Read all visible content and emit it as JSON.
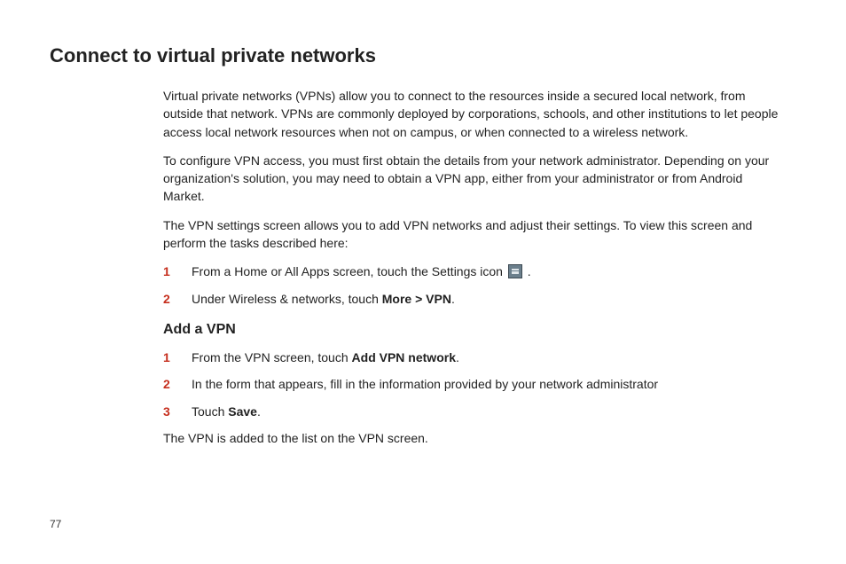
{
  "title": "Connect to virtual private networks",
  "para1": "Virtual private networks (VPNs) allow you to connect to the resources inside a secured local network, from outside that network. VPNs are commonly deployed by corporations, schools, and other institutions to let people access local network resources when not on campus, or when connected to a wireless network.",
  "para2": "To configure VPN access, you must first obtain the details from your network administrator. Depending on your organization's solution, you may need to obtain a VPN app, either from your administrator or from Android Market.",
  "para3": "The VPN settings screen allows you to add VPN networks and adjust their settings. To view this screen and perform the tasks described here:",
  "stepsA": {
    "s1_num": "1",
    "s1_pre": "From a Home or All Apps screen, touch the Settings icon ",
    "s1_post": " .",
    "s2_num": "2",
    "s2_pre": "Under Wireless & networks, touch ",
    "s2_bold": "More > VPN",
    "s2_post": "."
  },
  "subhead": "Add a VPN",
  "stepsB": {
    "s1_num": "1",
    "s1_pre": "From the VPN screen, touch ",
    "s1_bold": "Add VPN network",
    "s1_post": ".",
    "s2_num": "2",
    "s2_text": "In the form that appears, fill in the information provided by your network administrator",
    "s3_num": "3",
    "s3_pre": "Touch ",
    "s3_bold": "Save",
    "s3_post": "."
  },
  "para4": "The VPN is added to the list on the VPN screen.",
  "page_number": "77"
}
